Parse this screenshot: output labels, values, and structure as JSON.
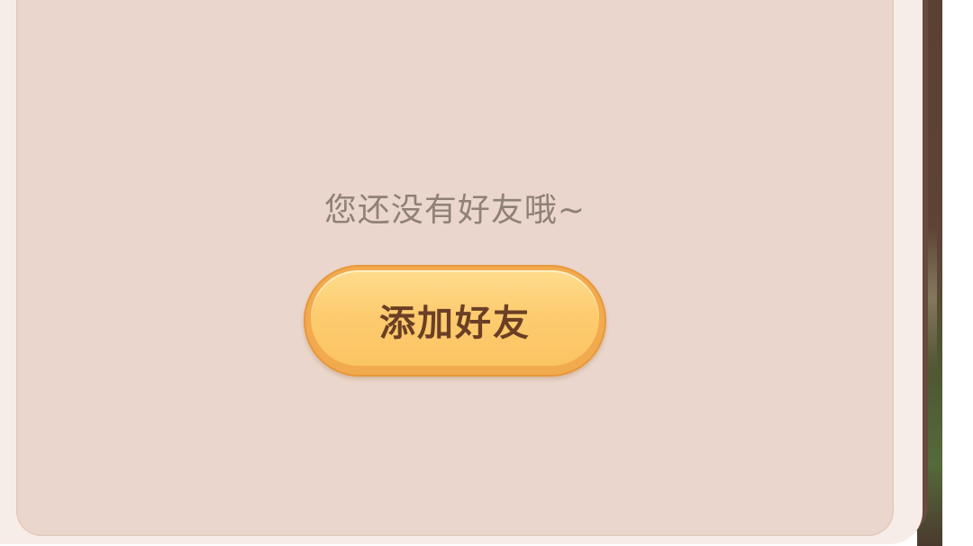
{
  "friends_panel": {
    "empty_message": "您还没有好友哦~",
    "add_friend_button_label": "添加好友"
  },
  "colors": {
    "panel_frame": "#f7ede8",
    "panel_content": "#ead6cc",
    "panel_border": "#6a4a3b",
    "button_fill": "#fdcc70",
    "button_text": "#6b3f25",
    "message_text": "#8f8178"
  }
}
